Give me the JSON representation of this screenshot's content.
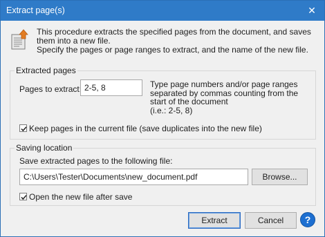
{
  "window": {
    "title": "Extract page(s)",
    "close_glyph": "✕"
  },
  "description": "This procedure extracts the specified pages from the document, and saves them into a new file.\nSpecify the pages or page ranges to extract, and the name of the new file.",
  "extracted_pages": {
    "legend": "Extracted pages",
    "pages_label": "Pages to extract:",
    "pages_value": "2-5, 8",
    "hint": "Type page numbers and/or page ranges separated by commas counting from the start of the document\n(i.e.: 2-5, 8)",
    "keep_label": "Keep pages in the current file (save duplicates into the new file)",
    "keep_checked": true
  },
  "saving_location": {
    "legend": "Saving location",
    "save_label": "Save extracted pages to the following file:",
    "path_value": "C:\\Users\\Tester\\Documents\\new_document.pdf",
    "browse_label": "Browse...",
    "open_label": "Open the new file after save",
    "open_checked": true
  },
  "footer": {
    "extract_label": "Extract",
    "cancel_label": "Cancel",
    "help_glyph": "?"
  },
  "colors": {
    "titlebar": "#2f7bc8",
    "accent": "#1d6fd1"
  },
  "icons": {
    "info": "document-extract-icon",
    "close": "close-icon",
    "help": "help-icon"
  }
}
